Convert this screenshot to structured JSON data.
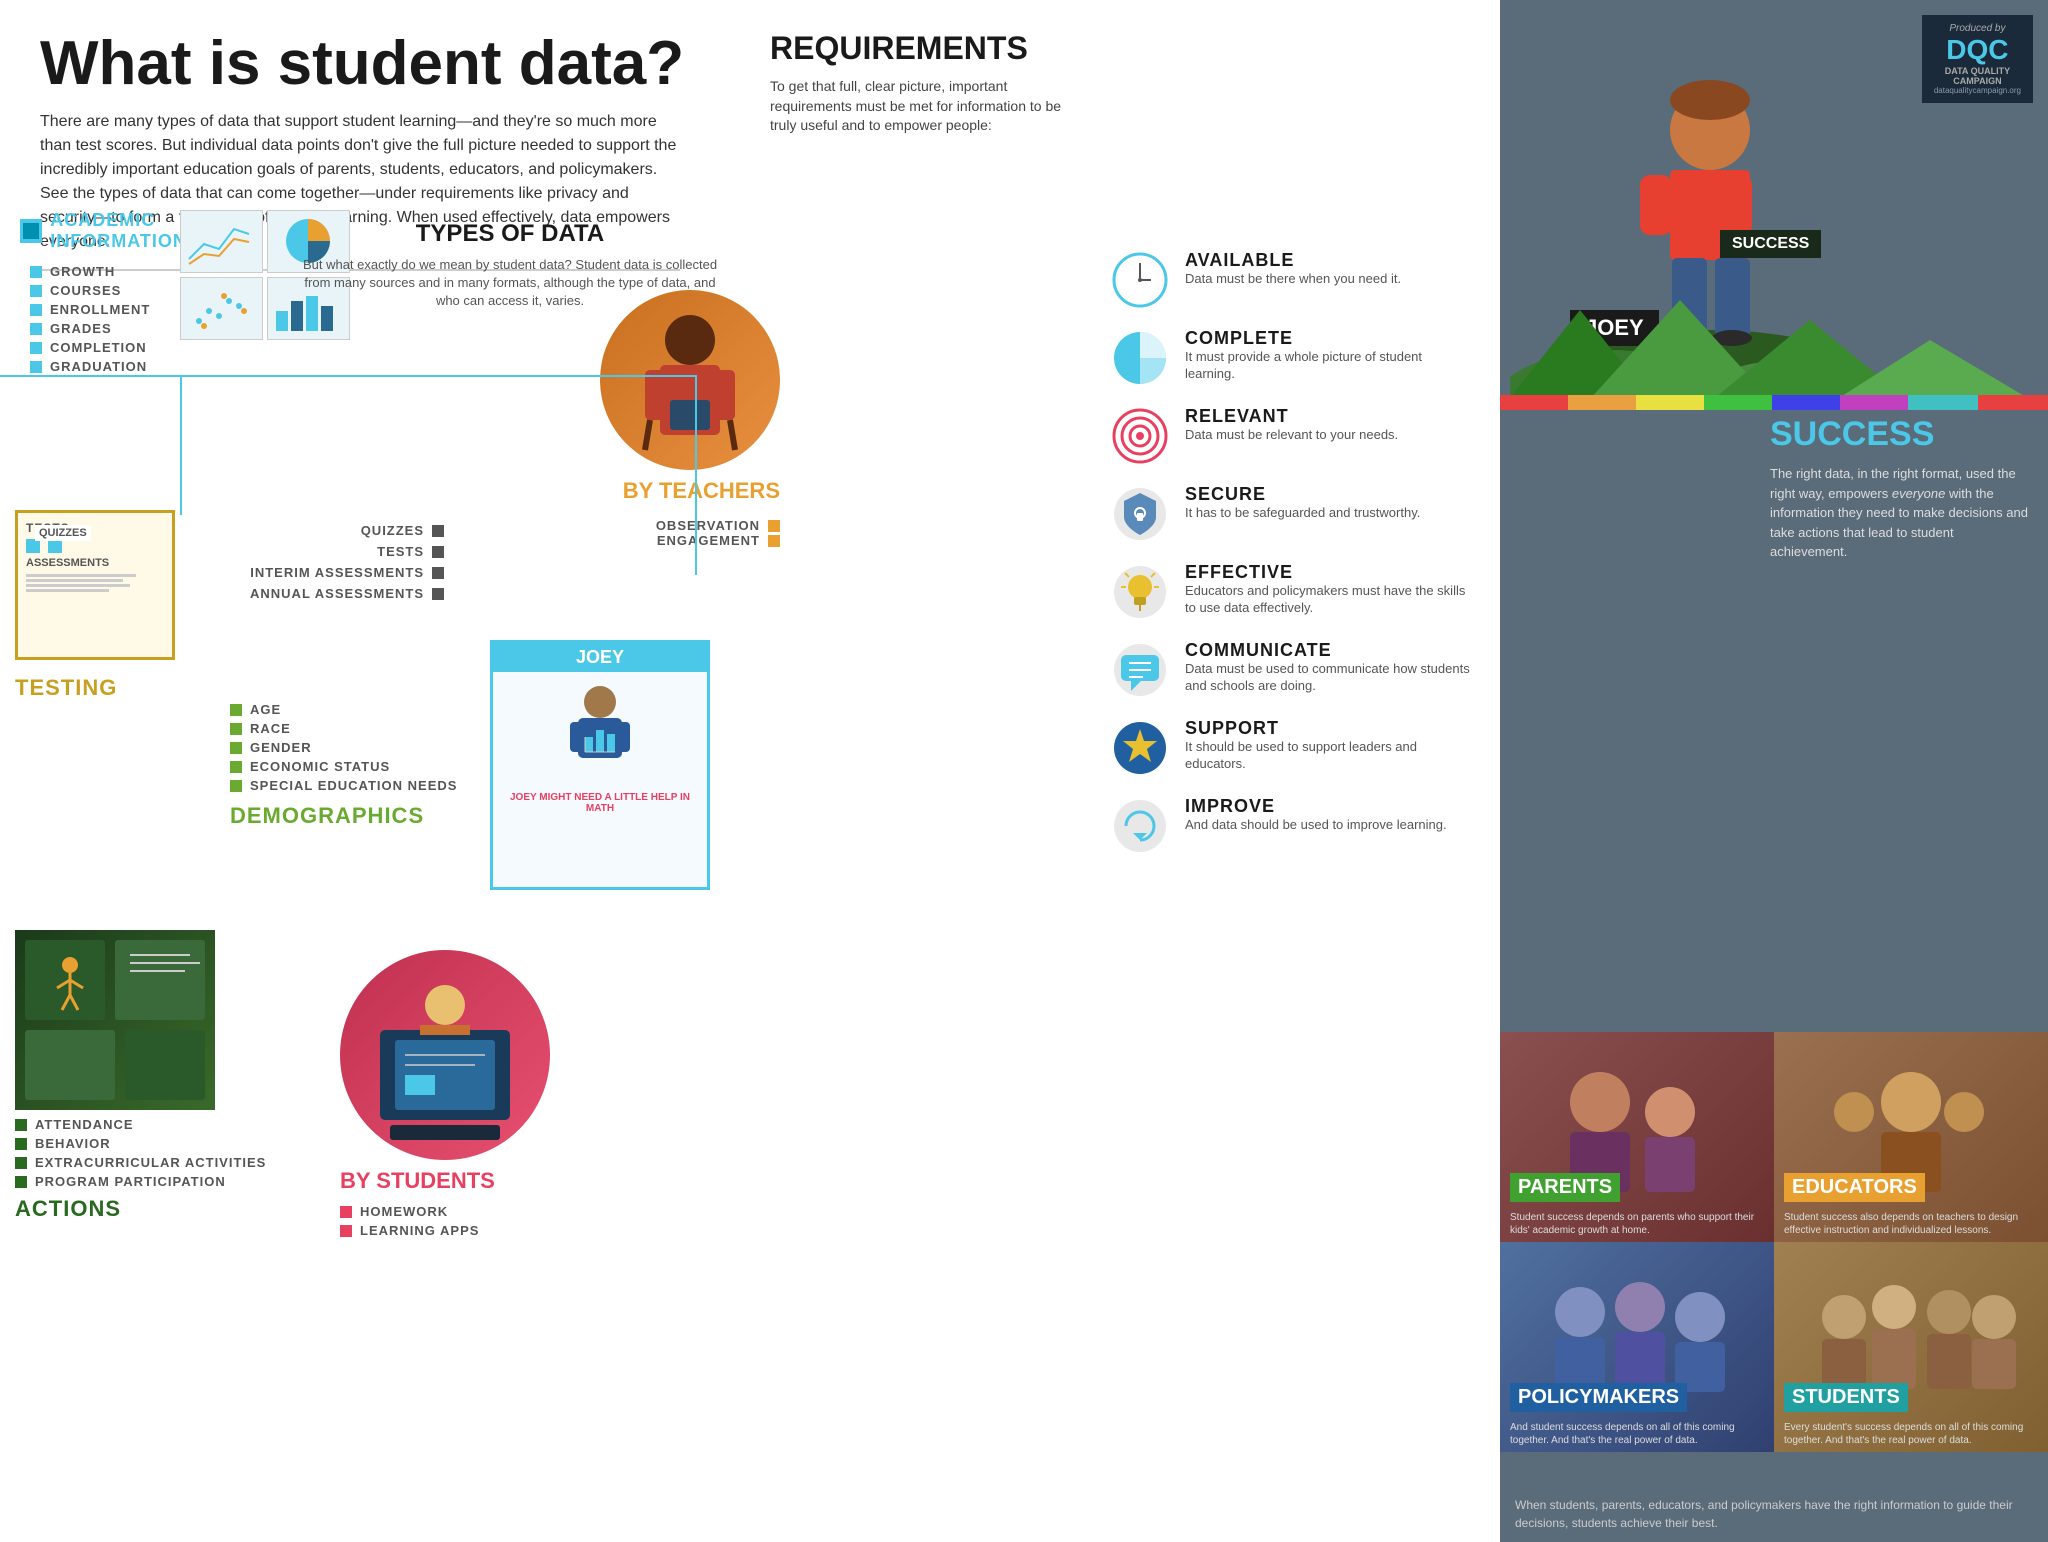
{
  "header": {
    "title": "What is student data?",
    "description": "There are many types of data that support student learning—and they're so much more than test scores. But individual data points don't give the full picture needed to support the incredibly important education goals of parents, students, educators, and policymakers. See the types of data that can come together—under requirements like privacy and security—to form a full picture of student learning. When used effectively, data empowers everyone."
  },
  "types_of_data": {
    "title": "TYPES OF DATA",
    "description": "But what exactly do we mean by student data? Student data is collected from many sources and in many formats, although the type of data, and who can access it, varies."
  },
  "academic_information": {
    "title": "ACADEMIC INFORMATION",
    "items": [
      "GROWTH",
      "COURSES",
      "ENROLLMENT",
      "GRADES",
      "COMPLETION",
      "GRADUATION"
    ]
  },
  "by_teachers": {
    "label": "BY TEACHERS",
    "items": [
      "OBSERVATION",
      "ENGAGEMENT"
    ]
  },
  "testing": {
    "title": "TESTING",
    "items": [
      "QUIZZES",
      "TESTS",
      "INTERIM ASSESSMENTS",
      "ANNUAL ASSESSMENTS"
    ]
  },
  "demographics": {
    "title": "DEMOGRAPHICS",
    "items": [
      "AGE",
      "RACE",
      "GENDER",
      "ECONOMIC STATUS",
      "SPECIAL EDUCATION NEEDS"
    ]
  },
  "actions": {
    "title": "ACTIONS",
    "items": [
      "ATTENDANCE",
      "BEHAVIOR",
      "EXTRACURRICULAR ACTIVITIES",
      "PROGRAM PARTICIPATION"
    ]
  },
  "by_students": {
    "label": "BY STUDENTS",
    "items": [
      "HOMEWORK",
      "LEARNING APPS"
    ]
  },
  "joey": {
    "name": "JOEY",
    "note": "JOEY MIGHT NEED A LITTLE HELP IN MATH"
  },
  "requirements": {
    "title": "REQUIREMENTS",
    "description": "To get that full, clear picture, important requirements must be met for information to be truly useful and to empower people:",
    "items": [
      {
        "name": "AVAILABLE",
        "description": "Data must be there when you need it.",
        "icon": "clock"
      },
      {
        "name": "COMPLETE",
        "description": "It must provide a whole picture of student learning.",
        "icon": "pie"
      },
      {
        "name": "RELEVANT",
        "description": "Data must be relevant to your needs.",
        "icon": "target"
      },
      {
        "name": "SECURE",
        "description": "It has to be safeguarded and trustworthy.",
        "icon": "shield"
      },
      {
        "name": "EFFECTIVE",
        "description": "Educators and policymakers must have the skills to use data effectively.",
        "icon": "bulb"
      },
      {
        "name": "COMMUNICATE",
        "description": "Data must be used to communicate how students and schools are doing.",
        "icon": "chat"
      },
      {
        "name": "SUPPORT",
        "description": "It should be used to support leaders and educators.",
        "icon": "star"
      },
      {
        "name": "IMPROVE",
        "description": "And data should be used to improve learning.",
        "icon": "arrows"
      }
    ]
  },
  "success": {
    "title": "SUCCESS",
    "description": "The right data, in the right format, used the right way, empowers everyone with the information they need to make decisions and take actions that lead to student achievement.",
    "banner": "SUCCESS",
    "joey_label": "JOEY"
  },
  "stakeholders": [
    {
      "label": "PARENTS",
      "color": "green",
      "description": "Student success depends on parents who support their kids' academic growth at home."
    },
    {
      "label": "EDUCATORS",
      "color": "orange",
      "description": "Student success also depends on teachers to design effective instruction and individualized lessons."
    },
    {
      "label": "POLICYMAKERS",
      "color": "blue",
      "description": "And student success depends on all of this coming together. And that's the real power of data."
    },
    {
      "label": "STUDENTS",
      "color": "teal",
      "description": "Every student's success depends on all of this coming together. And that's the real power of data."
    }
  ],
  "bottom_text": "When students, parents, educators, and policymakers have the right information to guide their decisions, students achieve their best.",
  "dqc": {
    "produced": "Produced by",
    "title": "DQC",
    "subtitle_line1": "DATA QUALITY",
    "subtitle_line2": "CAMPAIGN",
    "website": "dataqualitycampaign.org"
  }
}
